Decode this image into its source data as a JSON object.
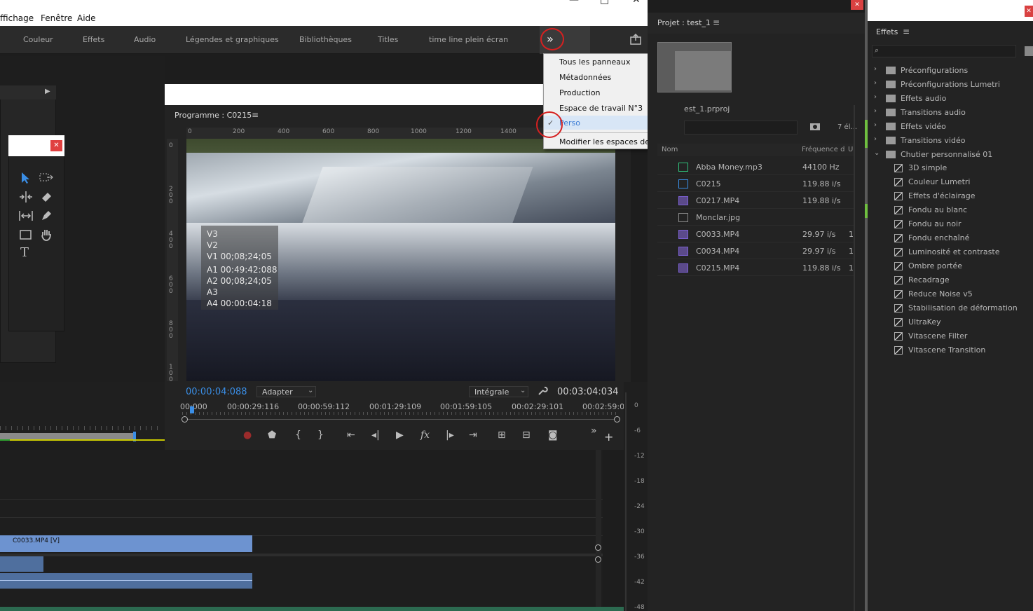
{
  "menubar": {
    "items": [
      "ffichage",
      "Fenêtre",
      "Aide"
    ],
    "min": "—",
    "max": "□",
    "close": "✕"
  },
  "workspaces": {
    "tabs": [
      "Couleur",
      "Effets",
      "Audio",
      "Légendes et graphiques",
      "Bibliothèques",
      "Titles",
      "time line plein écran"
    ],
    "overflow": "»",
    "export_icon": "export-icon"
  },
  "workspace_menu": {
    "items": [
      "Tous les panneaux",
      "Métadonnées",
      "Production",
      "Espace de travail N°3",
      "Perso",
      "Modifier les espaces de travail..."
    ],
    "checked": "✓"
  },
  "program": {
    "title": "Programme : C0215",
    "ruler_ticks": [
      "0",
      "200",
      "400",
      "600",
      "800",
      "1000",
      "1200",
      "1400"
    ],
    "vruler_ticks": [
      "0",
      "2\n0\n0",
      "4\n0\n0",
      "6\n0\n0",
      "8\n0\n0",
      "1\n0\n0"
    ],
    "overlay": [
      "V3",
      "V2",
      "V1 00;08;24;05",
      "A1 00:49:42:088",
      "A2 00;08;24;05",
      "A3",
      "A4 00:00:04:18"
    ],
    "current_time": "00:00:04:088",
    "fit": "Adapter",
    "quality": "Intégrale",
    "duration": "00:03:04:034",
    "timecodes": [
      "00:000",
      "00:00:29:116",
      "00:00:59:112",
      "00:01:29:109",
      "00:01:59:105",
      "00:02:29:101",
      "00:02:59:0"
    ],
    "more": "»",
    "add": "+",
    "fx": "fx"
  },
  "project": {
    "title": "Projet : test_1",
    "menu": "≡",
    "file": "est_1.prproj",
    "count": "7 él...",
    "col_name": "Nom",
    "col_rate": "Fréquence d",
    "col_u": "U",
    "rows": [
      {
        "name": "Abba Money.mp3",
        "rate": "44100  Hz",
        "u": ""
      },
      {
        "name": "C0215",
        "rate": "119.88 i/s",
        "u": ""
      },
      {
        "name": "C0217.MP4",
        "rate": "119.88 i/s",
        "u": ""
      },
      {
        "name": "Monclar.jpg",
        "rate": "",
        "u": ""
      },
      {
        "name": "C0033.MP4",
        "rate": "29.97 i/s",
        "u": "1"
      },
      {
        "name": "C0034.MP4",
        "rate": "29.97 i/s",
        "u": "1"
      },
      {
        "name": "C0215.MP4",
        "rate": "119.88 i/s",
        "u": "1"
      }
    ]
  },
  "effects": {
    "title": "Effets",
    "menu": "≡",
    "close": "✕",
    "folders": [
      "Préconfigurations",
      "Préconfigurations Lumetri",
      "Effets audio",
      "Transitions audio",
      "Effets vidéo",
      "Transitions vidéo",
      "Chutier personnalisé 01"
    ],
    "items": [
      "3D simple",
      "Couleur Lumetri",
      "Effets d'éclairage",
      "Fondu au blanc",
      "Fondu au noir",
      "Fondu enchaîné",
      "Luminosité et contraste",
      "Ombre portée",
      "Recadrage",
      "Reduce Noise v5",
      "Stabilisation de déformation",
      "UltraKey",
      "Vitascene Filter",
      "Vitascene Transition"
    ]
  },
  "timeline": {
    "clip_label": "C0033.MP4 [V]"
  },
  "meter": {
    "ticks": [
      "0",
      "-6",
      "-12",
      "-18",
      "-24",
      "-30",
      "-36",
      "-42",
      "-48"
    ]
  },
  "close_x": "✕"
}
